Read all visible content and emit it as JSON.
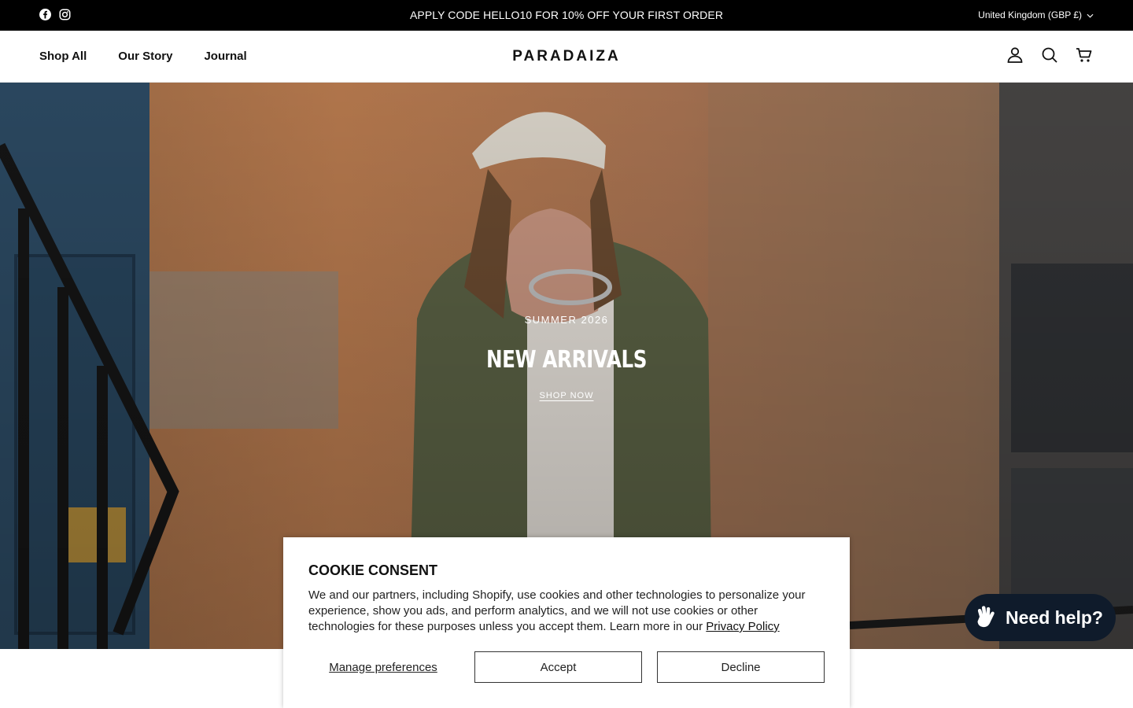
{
  "announcement": {
    "promo": "APPLY CODE HELLO10 FOR 10% OFF YOUR FIRST ORDER",
    "locale": "United Kingdom (GBP £)",
    "social_icons": [
      "facebook-icon",
      "instagram-icon"
    ]
  },
  "header": {
    "nav": [
      "Shop All",
      "Our Story",
      "Journal"
    ],
    "logo": "PARADAIZA",
    "tools": [
      "account-icon",
      "search-icon",
      "cart-icon"
    ]
  },
  "hero": {
    "eyebrow": "SUMMER 2026",
    "title": "NEW ARRIVALS",
    "cta": "SHOP NOW"
  },
  "cookie": {
    "title": "COOKIE CONSENT",
    "body": "We and our partners, including Shopify, use cookies and other technologies to personalize your experience, show you ads, and perform analytics, and we will not use cookies or other technologies for these purposes unless you accept them. Learn more in our ",
    "policy_link": "Privacy Policy",
    "manage": "Manage preferences",
    "accept": "Accept",
    "decline": "Decline"
  },
  "help": {
    "label": "Need help?"
  },
  "colors": {
    "announcement_bg": "#000000",
    "help_bg": "#0f1b2b"
  }
}
